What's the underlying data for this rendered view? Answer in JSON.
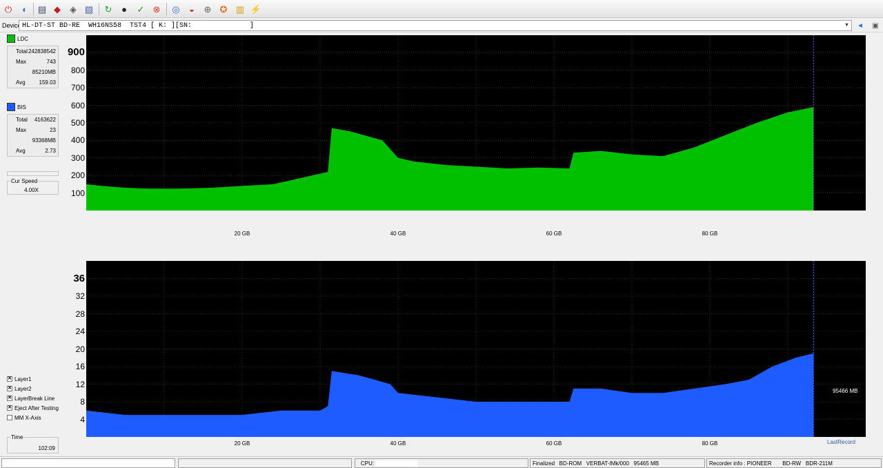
{
  "toolbar": {
    "icons": [
      "power-icon",
      "drive-icon",
      "monitor-icon",
      "eraser-icon",
      "disc-icon",
      "tray-icon",
      "refresh-icon",
      "disc-write-icon",
      "check-icon",
      "stop-icon",
      "cd-icon",
      "burn-icon",
      "disc-info-icon",
      "test-icon",
      "chart-icon",
      "tool-icon"
    ]
  },
  "device": {
    "label": "Device:",
    "value": "HL-DT-ST BD-RE  WH16NS58  TST4 [ K: ][SN:              ]"
  },
  "ldc": {
    "label": "LDC",
    "color": "#00c000",
    "stats": [
      {
        "key": "Total",
        "value": "242838542"
      },
      {
        "key": "Max",
        "value": "743"
      },
      {
        "key": "",
        "value": "85210MB"
      },
      {
        "key": "Avg",
        "value": "159.03"
      }
    ]
  },
  "bis": {
    "label": "BIS",
    "color": "#1e5cff",
    "stats": [
      {
        "key": "Total",
        "value": "4163622"
      },
      {
        "key": "Max",
        "value": "23"
      },
      {
        "key": "",
        "value": "93368MB"
      },
      {
        "key": "Avg",
        "value": "2.73"
      }
    ]
  },
  "speed": {
    "label": "Cur Speed",
    "value": "4.00X"
  },
  "options": [
    {
      "label": "Layer1",
      "checked": true
    },
    {
      "label": "Layer2",
      "checked": true
    },
    {
      "label": "LayerBreak Line",
      "checked": true
    },
    {
      "label": "Eject After Testing",
      "checked": true
    },
    {
      "label": "MM X-Axis",
      "checked": false
    }
  ],
  "time": {
    "label": "Time",
    "value": "102:09"
  },
  "chart_data": [
    {
      "type": "area",
      "series": [
        {
          "name": "LDC",
          "color": "#00c000"
        }
      ],
      "xlim": [
        0,
        100
      ],
      "ylim": [
        0,
        1000
      ],
      "x_ticks": [
        "20 GB",
        "40 GB",
        "60 GB",
        "80 GB"
      ],
      "x_tick_values": [
        20,
        40,
        60,
        80
      ],
      "y_ticks": [
        "900",
        "800",
        "700",
        "600",
        "500",
        "400",
        "300",
        "200",
        "100"
      ],
      "y_tick_values": [
        900,
        800,
        700,
        600,
        500,
        400,
        300,
        200,
        100
      ],
      "end_gb": 93.3,
      "x": [
        0,
        2,
        5,
        8,
        12,
        16,
        20,
        24,
        28,
        31,
        31.5,
        34,
        38,
        40,
        42,
        46,
        50,
        54,
        58,
        62,
        62.5,
        66,
        70,
        74,
        78,
        82,
        86,
        90,
        93.3
      ],
      "y": [
        150,
        140,
        130,
        125,
        125,
        130,
        140,
        150,
        190,
        220,
        470,
        450,
        400,
        300,
        280,
        260,
        250,
        240,
        245,
        240,
        330,
        340,
        320,
        310,
        360,
        430,
        500,
        560,
        590
      ]
    },
    {
      "type": "area",
      "series": [
        {
          "name": "BIS",
          "color": "#1e5cff"
        }
      ],
      "xlim": [
        0,
        100
      ],
      "ylim": [
        0,
        40
      ],
      "x_ticks": [
        "20 GB",
        "40 GB",
        "60 GB",
        "80 GB"
      ],
      "x_tick_values": [
        20,
        40,
        60,
        80
      ],
      "y_ticks": [
        "36",
        "32",
        "28",
        "24",
        "20",
        "16",
        "12",
        "8",
        "4"
      ],
      "y_tick_values": [
        36,
        32,
        28,
        24,
        20,
        16,
        12,
        8,
        4
      ],
      "end_gb": 93.3,
      "end_label": "95466 MB",
      "x": [
        0,
        5,
        10,
        15,
        20,
        25,
        30,
        31,
        31.5,
        35,
        39,
        40,
        45,
        50,
        55,
        60,
        62,
        62.5,
        66,
        70,
        74,
        78,
        82,
        85,
        88,
        91,
        93.3
      ],
      "y": [
        6,
        5,
        5,
        5,
        5,
        6,
        6,
        7,
        15,
        14,
        12,
        10,
        9,
        8,
        8,
        8,
        8,
        11,
        11,
        10,
        10,
        11,
        12,
        13,
        16,
        18,
        19
      ]
    }
  ],
  "last_record": "LastRecord",
  "status": {
    "cpu_label": "CPU:",
    "disc_info": "Finalized   BD-ROM   VERBAT-IMk/000   95465 MB",
    "recorder": "Recorder info : PIONEER       BD-RW   BDR-211M"
  }
}
